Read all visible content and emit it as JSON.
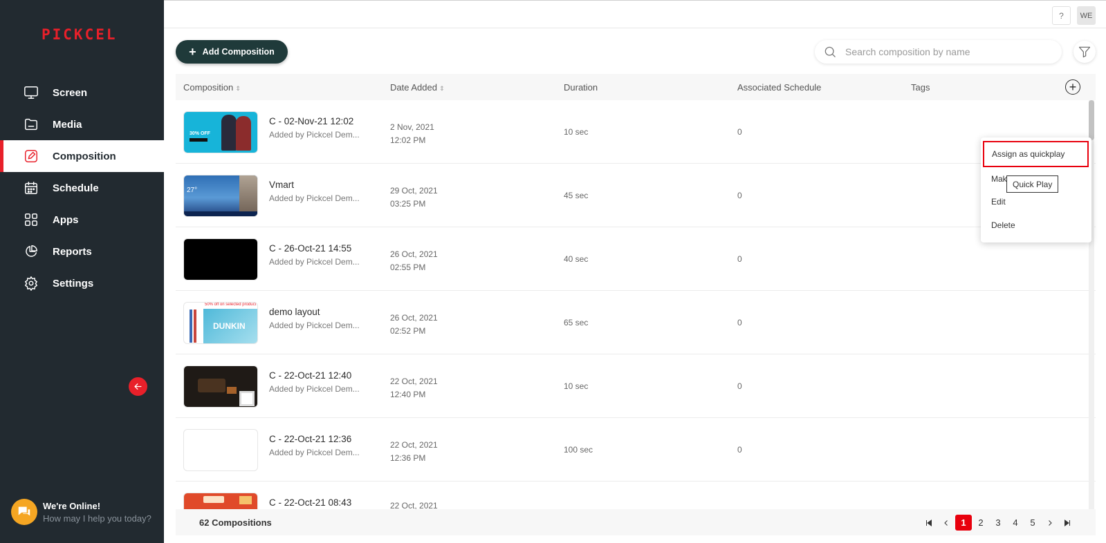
{
  "app": {
    "logo": "PICKCEL"
  },
  "sidebar": {
    "items": [
      {
        "label": "Screen",
        "icon": "monitor-icon"
      },
      {
        "label": "Media",
        "icon": "folder-icon"
      },
      {
        "label": "Composition",
        "icon": "edit-icon",
        "active": true
      },
      {
        "label": "Schedule",
        "icon": "calendar-icon"
      },
      {
        "label": "Apps",
        "icon": "apps-grid-icon"
      },
      {
        "label": "Reports",
        "icon": "pie-chart-icon"
      },
      {
        "label": "Settings",
        "icon": "gear-icon"
      }
    ],
    "chat": {
      "title": "We're Online!",
      "subtitle": "How may I help you today?"
    }
  },
  "topbar": {
    "help": "?",
    "avatar": "WE"
  },
  "toolbar": {
    "add_label": "Add Composition",
    "search_placeholder": "Search composition by name"
  },
  "table": {
    "columns": [
      "Composition",
      "Date Added",
      "Duration",
      "Associated Schedule",
      "Tags"
    ],
    "rows": [
      {
        "name": "C - 02-Nov-21 12:02",
        "added_by": "Added by Pickcel Dem...",
        "date": "2 Nov, 2021",
        "time": "12:02 PM",
        "duration": "10 sec",
        "schedule": "0"
      },
      {
        "name": "Vmart",
        "added_by": "Added by Pickcel Dem...",
        "date": "29 Oct, 2021",
        "time": "03:25 PM",
        "duration": "45 sec",
        "schedule": "0"
      },
      {
        "name": "C - 26-Oct-21 14:55",
        "added_by": "Added by Pickcel Dem...",
        "date": "26 Oct, 2021",
        "time": "02:55 PM",
        "duration": "40 sec",
        "schedule": "0"
      },
      {
        "name": "demo layout",
        "added_by": "Added by Pickcel Dem...",
        "date": "26 Oct, 2021",
        "time": "02:52 PM",
        "duration": "65 sec",
        "schedule": "0"
      },
      {
        "name": "C - 22-Oct-21 12:40",
        "added_by": "Added by Pickcel Dem...",
        "date": "22 Oct, 2021",
        "time": "12:40 PM",
        "duration": "10 sec",
        "schedule": "0"
      },
      {
        "name": "C - 22-Oct-21 12:36",
        "added_by": "Added by Pickcel Dem...",
        "date": "22 Oct, 2021",
        "time": "12:36 PM",
        "duration": "100 sec",
        "schedule": "0"
      },
      {
        "name": "C - 22-Oct-21 08:43",
        "added_by": "",
        "date": "22 Oct, 2021",
        "time": "",
        "duration": "",
        "schedule": ""
      }
    ]
  },
  "thumbnails": {
    "t1_text": "30% OFF",
    "t2_text": "27°",
    "t4_banner": "50% off on selected product",
    "t4_brand": "DUNKIN"
  },
  "footer": {
    "count": "62 Compositions",
    "pages": [
      "1",
      "2",
      "3",
      "4",
      "5"
    ],
    "current_page": "1"
  },
  "context_menu": {
    "items": [
      "Assign as quickplay",
      "Mak",
      "Edit",
      "Delete"
    ],
    "tooltip": "Quick Play"
  },
  "colors": {
    "accent": "#e8202a",
    "sidebar": "#222a30",
    "primary_button": "#1f3a3a"
  }
}
